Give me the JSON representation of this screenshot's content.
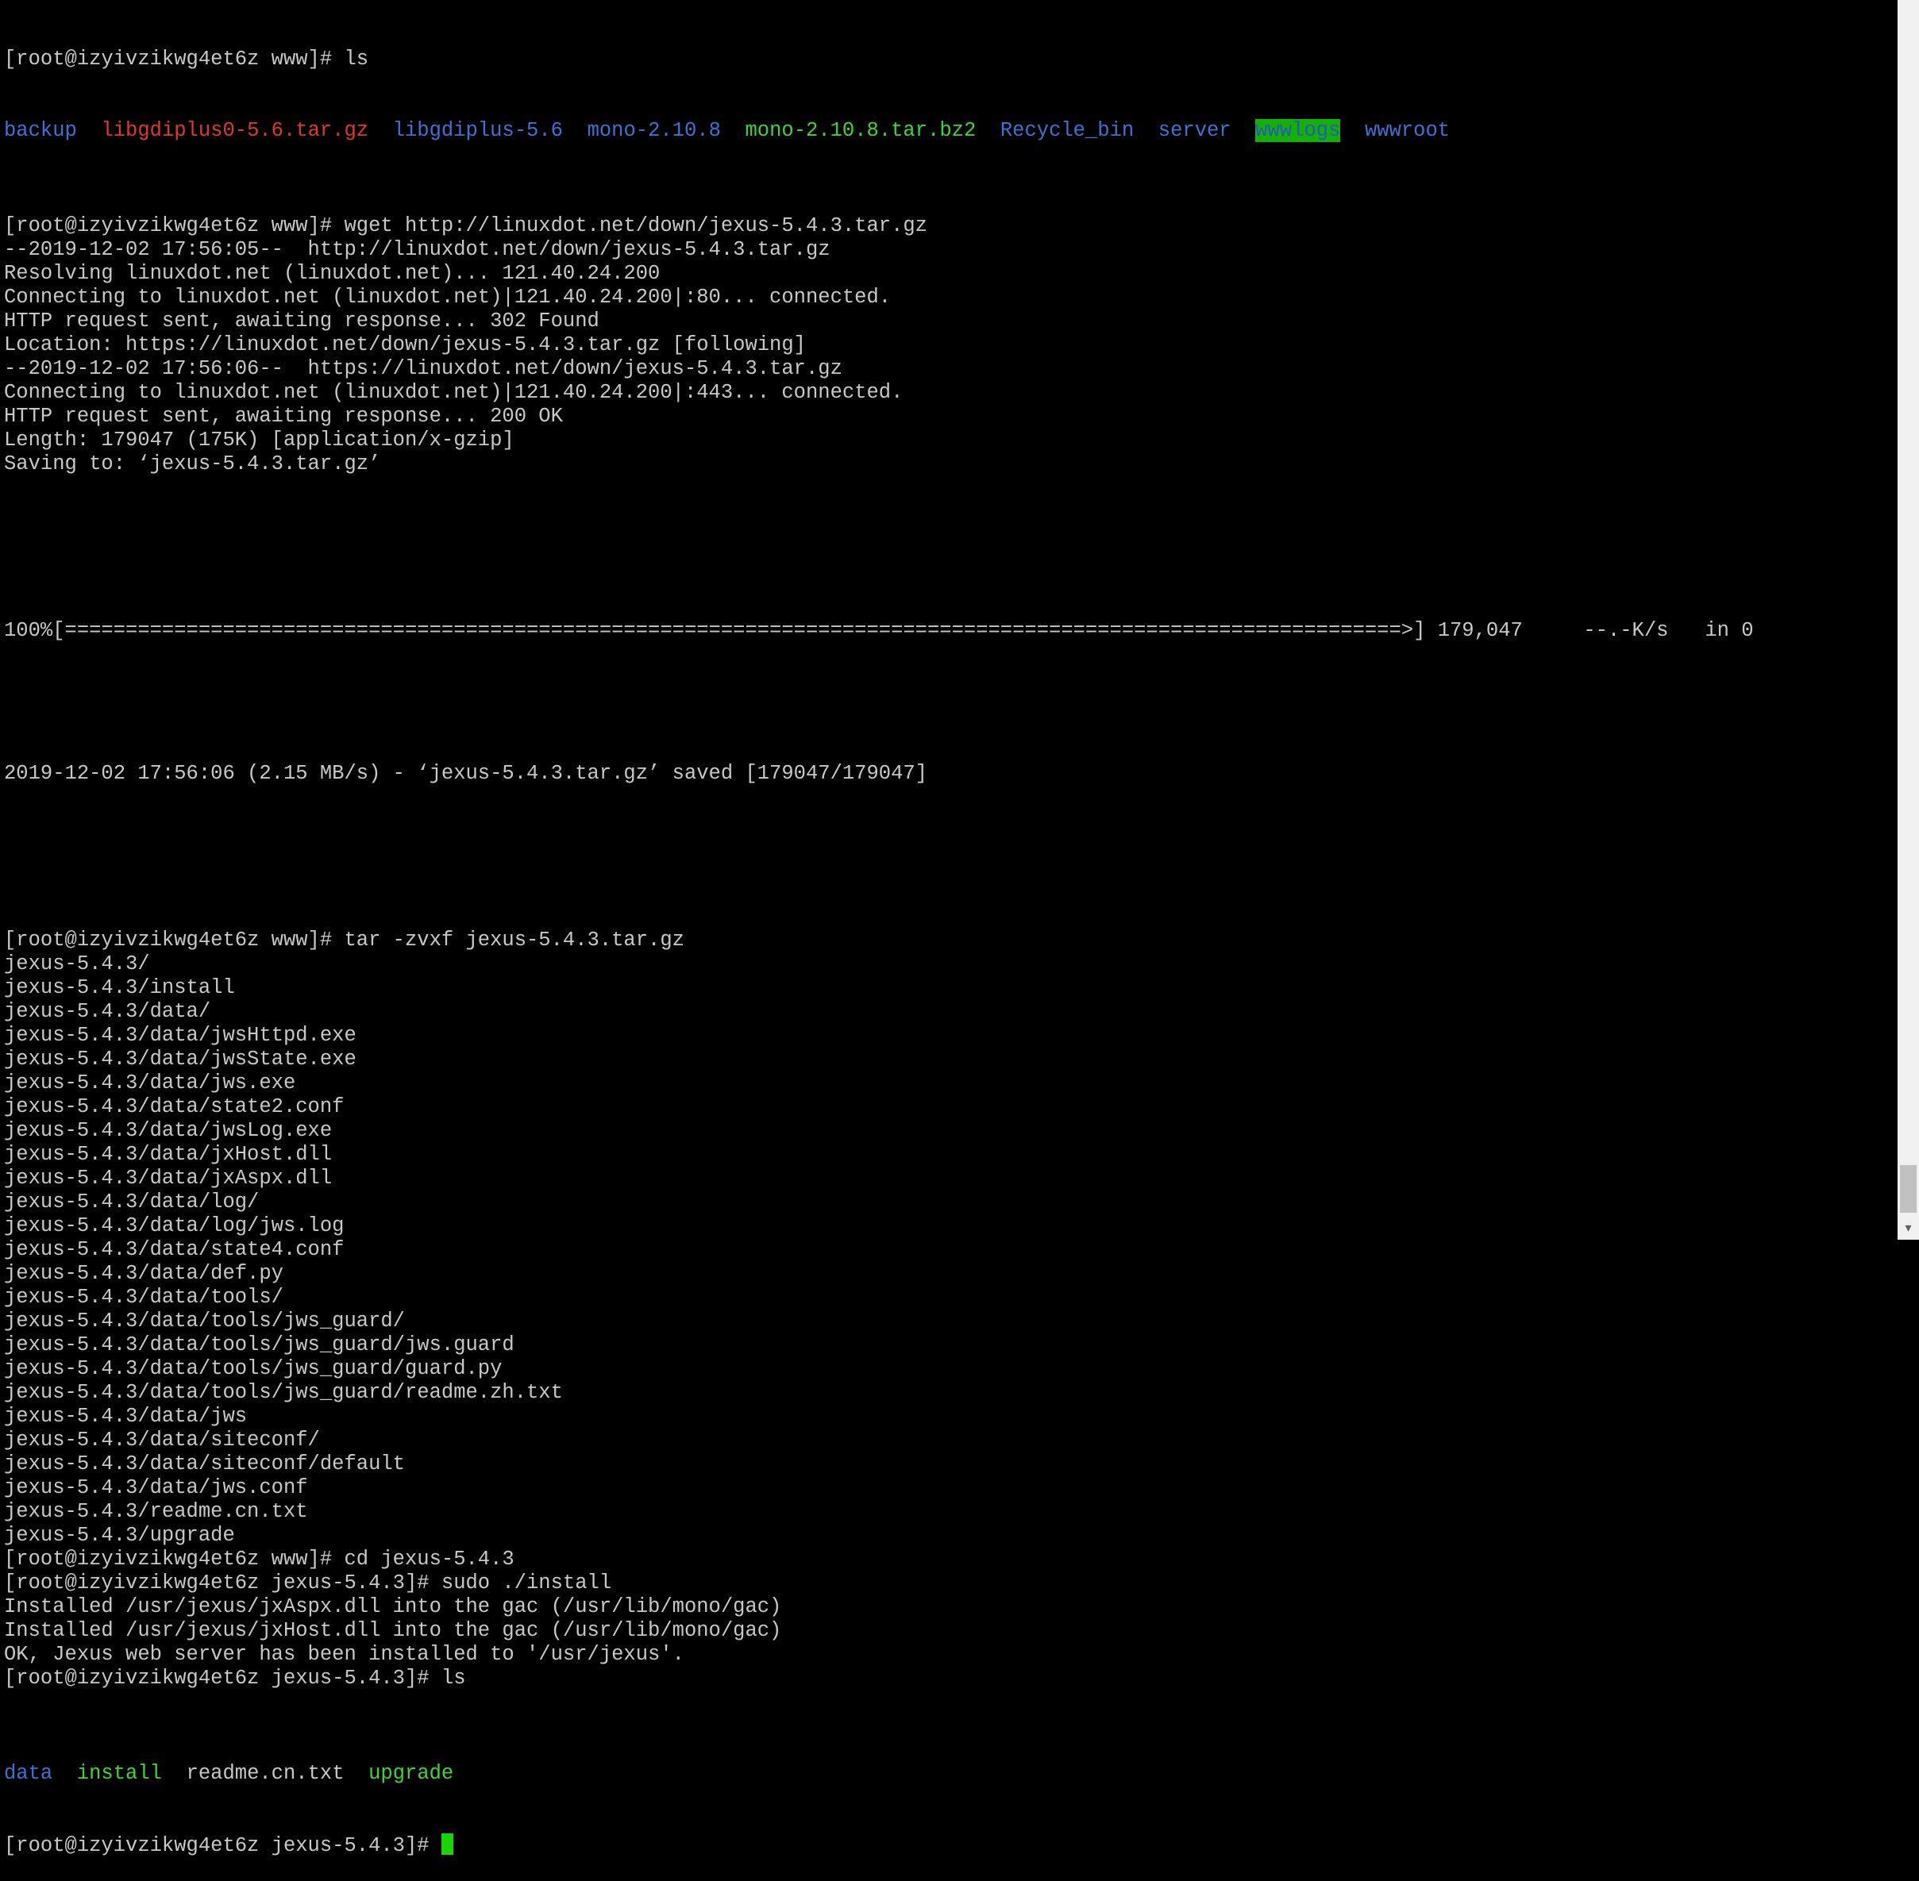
{
  "ls1": {
    "prompt": "[root@izyivzikwg4et6z www]# ls",
    "entries": [
      "backup",
      "libgdiplus0-5.6.tar.gz",
      "libgdiplus-5.6",
      "mono-2.10.8",
      "mono-2.10.8.tar.bz2",
      "Recycle_bin",
      "server",
      "wwwlogs",
      "wwwroot"
    ]
  },
  "wget_lines": [
    "[root@izyivzikwg4et6z www]# wget http://linuxdot.net/down/jexus-5.4.3.tar.gz",
    "--2019-12-02 17:56:05--  http://linuxdot.net/down/jexus-5.4.3.tar.gz",
    "Resolving linuxdot.net (linuxdot.net)... 121.40.24.200",
    "Connecting to linuxdot.net (linuxdot.net)|121.40.24.200|:80... connected.",
    "HTTP request sent, awaiting response... 302 Found",
    "Location: https://linuxdot.net/down/jexus-5.4.3.tar.gz [following]",
    "--2019-12-02 17:56:06--  https://linuxdot.net/down/jexus-5.4.3.tar.gz",
    "Connecting to linuxdot.net (linuxdot.net)|121.40.24.200|:443... connected.",
    "HTTP request sent, awaiting response... 200 OK",
    "Length: 179047 (175K) [application/x-gzip]",
    "Saving to: ‘jexus-5.4.3.tar.gz’"
  ],
  "progress_line": "100%[==============================================================================================================>] 179,047     --.-K/s   in 0",
  "progress_percent": 100,
  "saved_line": "2019-12-02 17:56:06 (2.15 MB/s) - ‘jexus-5.4.3.tar.gz’ saved [179047/179047]",
  "tar_lines": [
    "[root@izyivzikwg4et6z www]# tar -zvxf jexus-5.4.3.tar.gz",
    "jexus-5.4.3/",
    "jexus-5.4.3/install",
    "jexus-5.4.3/data/",
    "jexus-5.4.3/data/jwsHttpd.exe",
    "jexus-5.4.3/data/jwsState.exe",
    "jexus-5.4.3/data/jws.exe",
    "jexus-5.4.3/data/state2.conf",
    "jexus-5.4.3/data/jwsLog.exe",
    "jexus-5.4.3/data/jxHost.dll",
    "jexus-5.4.3/data/jxAspx.dll",
    "jexus-5.4.3/data/log/",
    "jexus-5.4.3/data/log/jws.log",
    "jexus-5.4.3/data/state4.conf",
    "jexus-5.4.3/data/def.py",
    "jexus-5.4.3/data/tools/",
    "jexus-5.4.3/data/tools/jws_guard/",
    "jexus-5.4.3/data/tools/jws_guard/jws.guard",
    "jexus-5.4.3/data/tools/jws_guard/guard.py",
    "jexus-5.4.3/data/tools/jws_guard/readme.zh.txt",
    "jexus-5.4.3/data/jws",
    "jexus-5.4.3/data/siteconf/",
    "jexus-5.4.3/data/siteconf/default",
    "jexus-5.4.3/data/jws.conf",
    "jexus-5.4.3/readme.cn.txt",
    "jexus-5.4.3/upgrade",
    "[root@izyivzikwg4et6z www]# cd jexus-5.4.3",
    "[root@izyivzikwg4et6z jexus-5.4.3]# sudo ./install",
    "Installed /usr/jexus/jxAspx.dll into the gac (/usr/lib/mono/gac)",
    "Installed /usr/jexus/jxHost.dll into the gac (/usr/lib/mono/gac)",
    "OK, Jexus web server has been installed to '/usr/jexus'.",
    "[root@izyivzikwg4et6z jexus-5.4.3]# ls"
  ],
  "ls2": {
    "entries": [
      "data",
      "install",
      "readme.cn.txt",
      "upgrade"
    ]
  },
  "final_prompt": "[root@izyivzikwg4et6z jexus-5.4.3]# ",
  "colors": {
    "background": "#000000",
    "foreground": "#c8c8c8",
    "directory": "#3b73d6",
    "archive": "#e0382c",
    "executable": "#3fd630",
    "highlight_bg": "#12b300",
    "cursor": "#19d600"
  },
  "icons": {
    "scroll_down": "▾"
  }
}
